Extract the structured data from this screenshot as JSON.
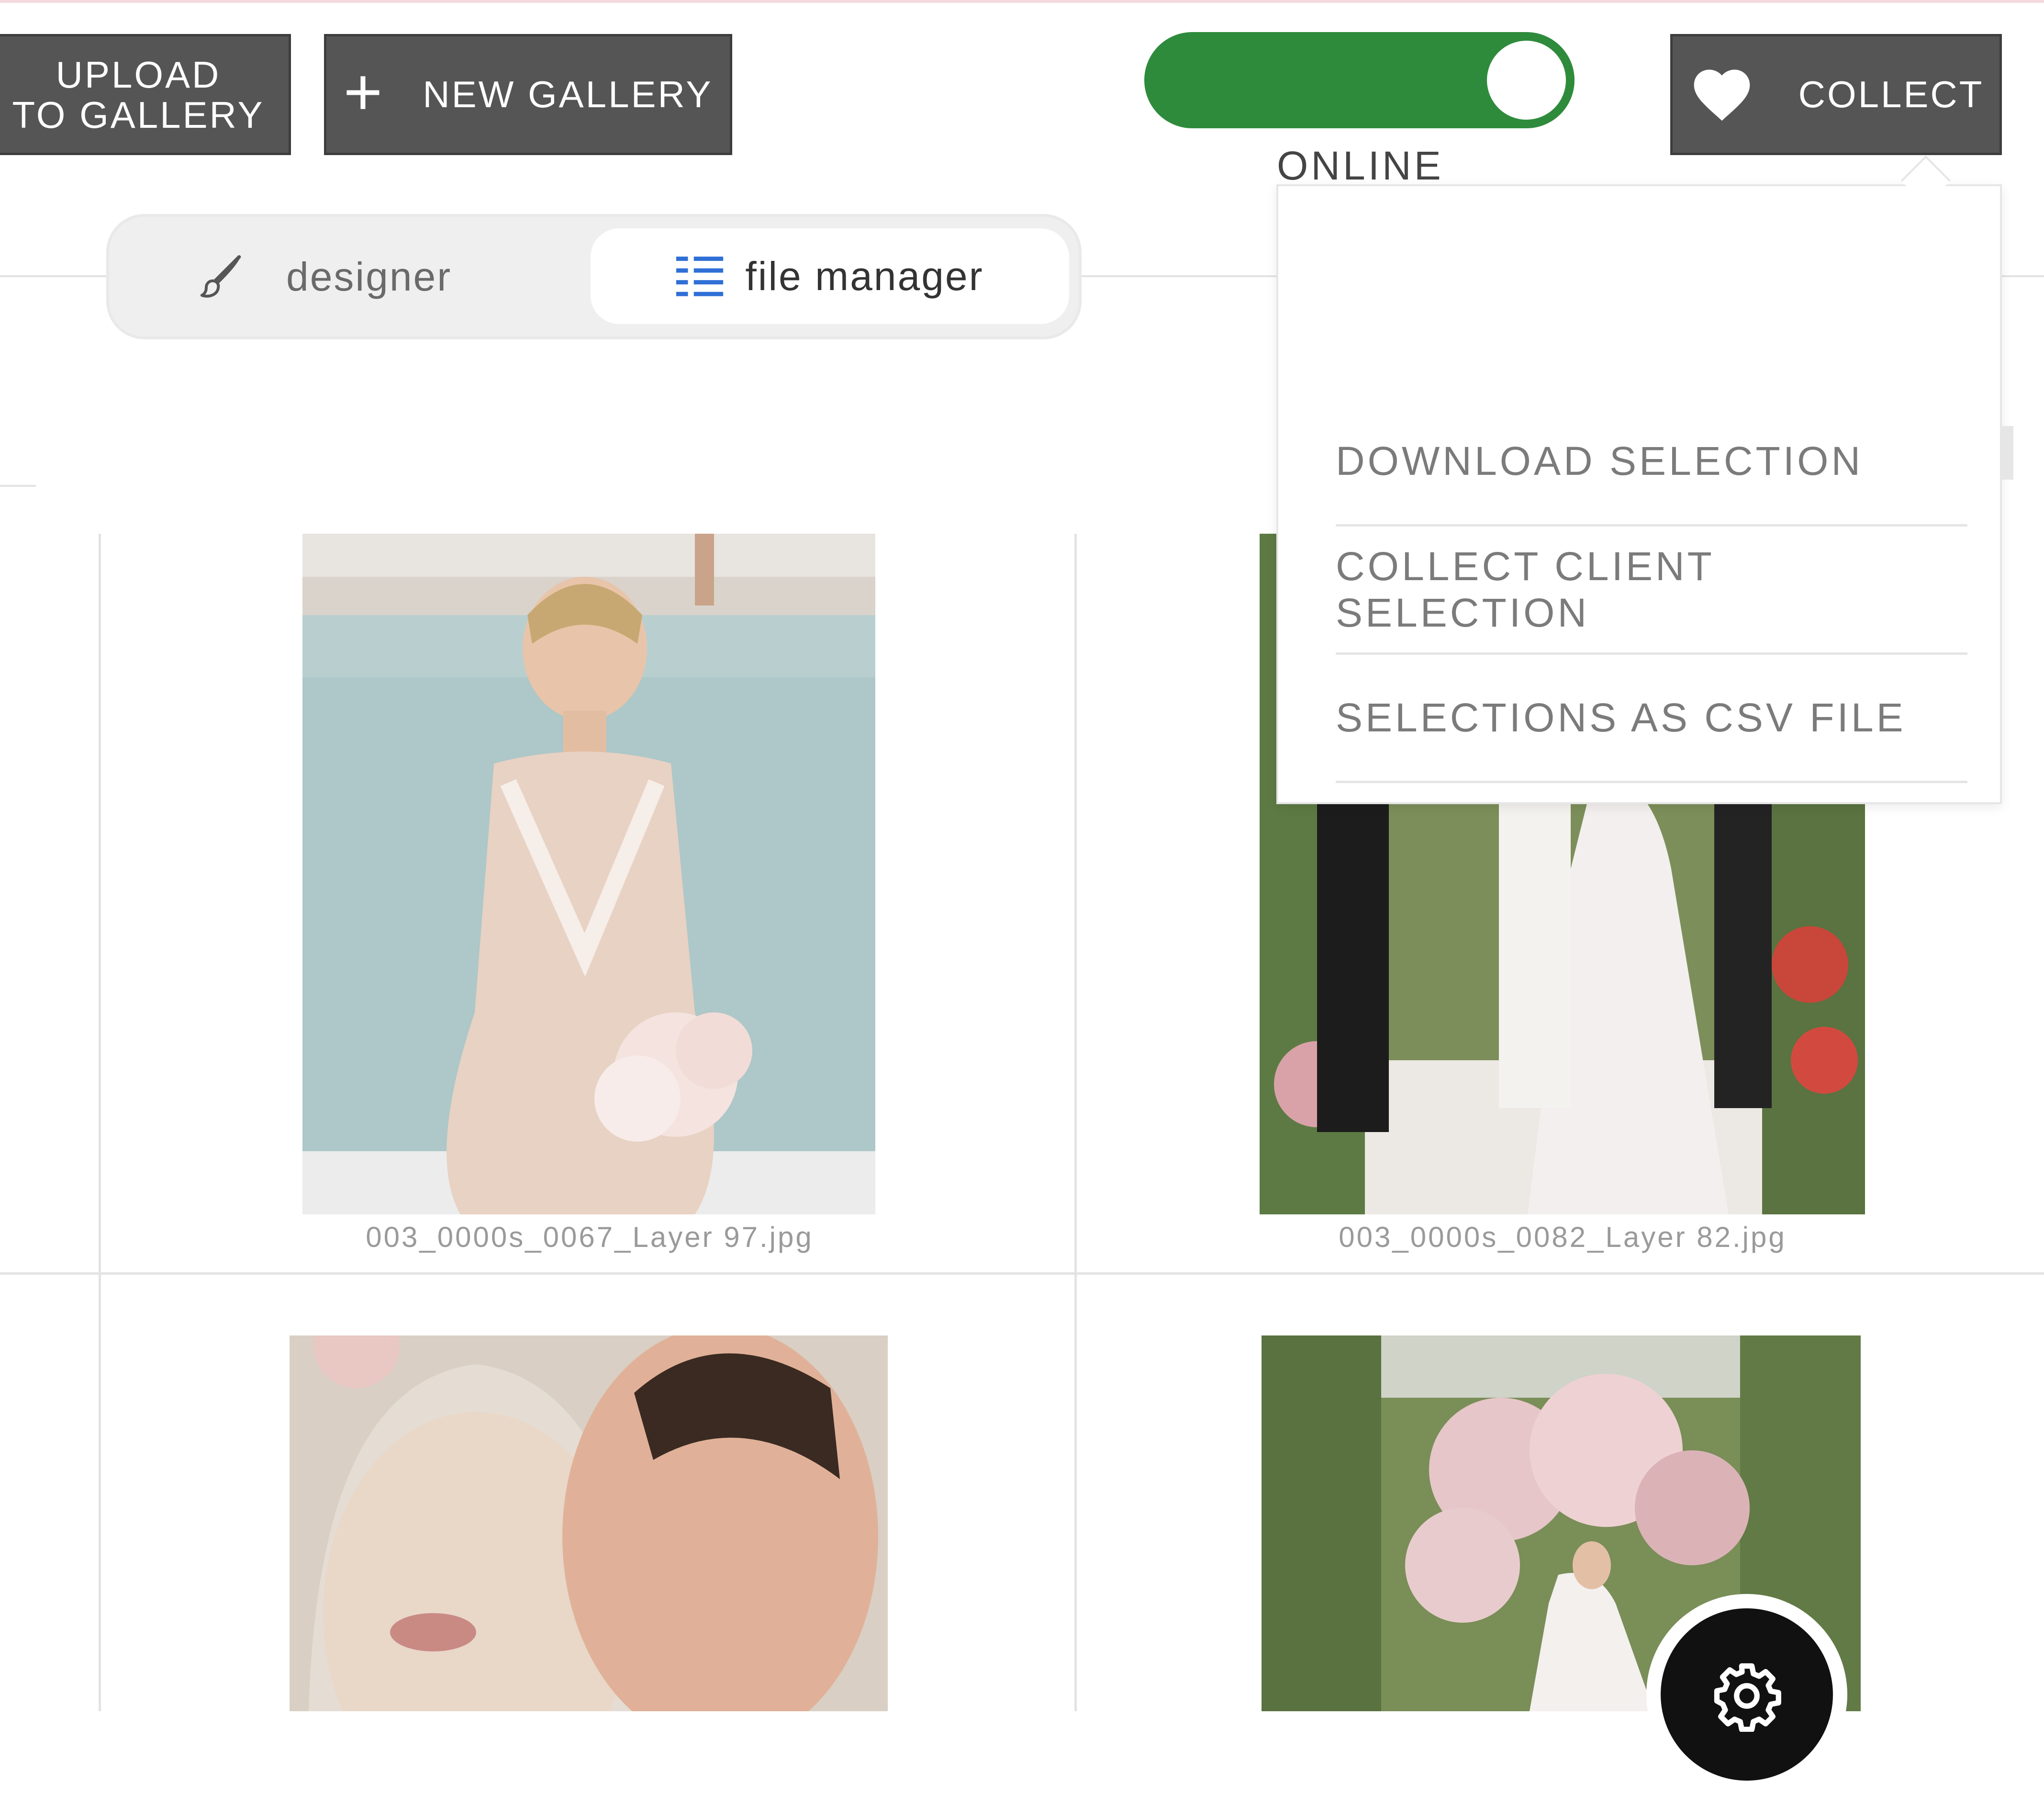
{
  "toolbar": {
    "upload_line1": "UPLOAD",
    "upload_line2": "TO GALLERY",
    "new_gallery": "NEW GALLERY",
    "collect": "COLLECT",
    "status_label": "ONLINE",
    "online_enabled": true,
    "toggle_color": "#2e8b3c"
  },
  "view_tabs": {
    "designer": "designer",
    "file_manager": "file manager",
    "active": "file manager",
    "accent_color": "#2f6fd6"
  },
  "collect_menu": {
    "items": [
      "DOWNLOAD SELECTION",
      "COLLECT CLIENT SELECTION",
      "SELECTIONS AS CSV FILE"
    ]
  },
  "gallery": {
    "items": [
      {
        "filename": "003_0000s_0067_Layer 97.jpg"
      },
      {
        "filename": "003_0000s_0082_Layer 82.jpg"
      },
      {
        "filename": ""
      },
      {
        "filename": ""
      }
    ]
  },
  "icons": [
    "heart-icon",
    "plus-icon",
    "brush-icon",
    "list-icon",
    "gear-icon"
  ]
}
